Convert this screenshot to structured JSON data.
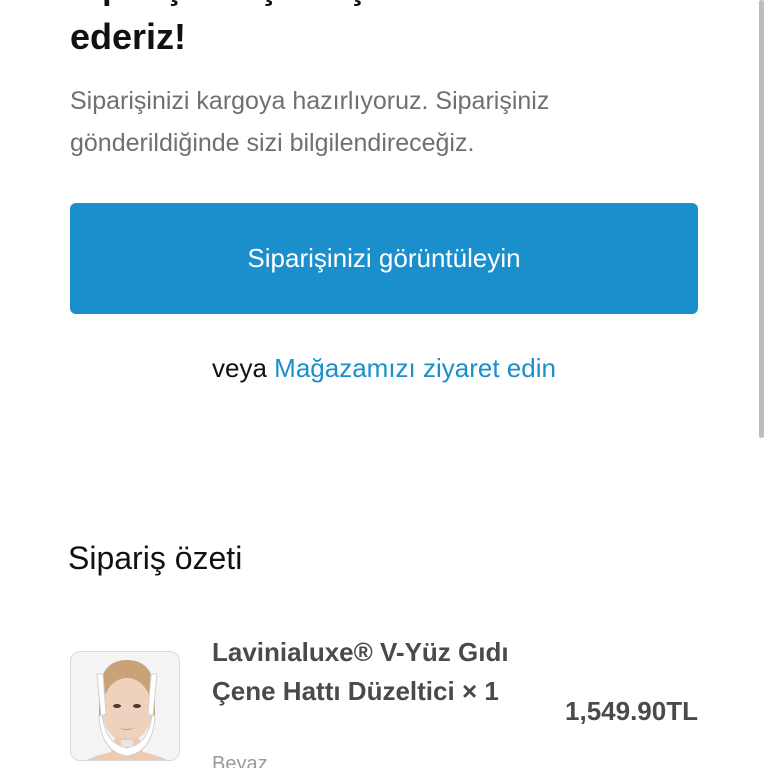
{
  "header": {
    "title_cut": "Siparişiniz için teşekkür",
    "title": "ederiz!",
    "message": "Siparişinizi kargoya hazırlıyoruz. Siparişiniz gönderildiğinde sizi bilgilendireceğiz."
  },
  "actions": {
    "view_order_label": "Siparişinizi görüntüleyin",
    "or_text": "veya",
    "visit_store_label": "Mağazamızı ziyaret edin"
  },
  "summary": {
    "heading": "Sipariş özeti",
    "items": [
      {
        "name": "Lavinialuxe® V-Yüz Gıdı Çene Hattı Düzeltici",
        "quantity": "× 1",
        "variant": "Beyaz",
        "price": "1,549.90TL",
        "image": "product-photo-face-strap"
      }
    ]
  },
  "colors": {
    "accent": "#1a8fcb",
    "muted_text": "#707070",
    "product_text": "#4a4a4a"
  }
}
